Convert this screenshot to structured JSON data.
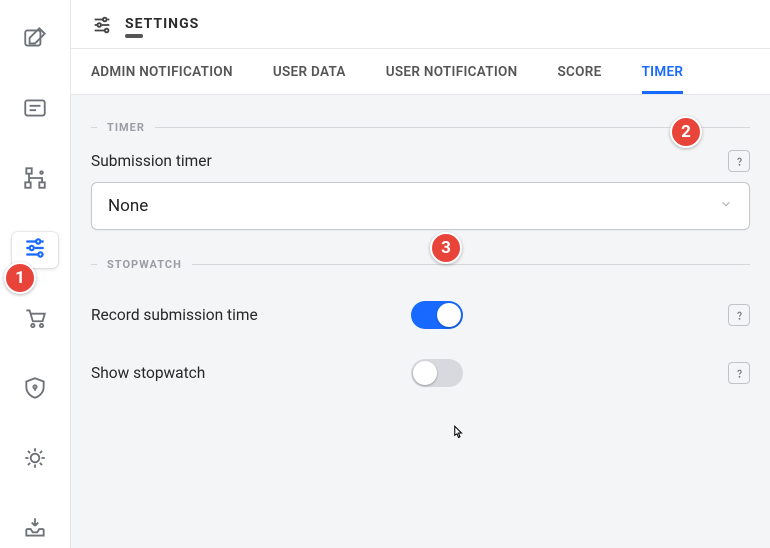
{
  "page": {
    "title": "SETTINGS"
  },
  "tabs": [
    {
      "label": "ADMIN NOTIFICATION",
      "active": false
    },
    {
      "label": "USER DATA",
      "active": false
    },
    {
      "label": "USER NOTIFICATION",
      "active": false
    },
    {
      "label": "SCORE",
      "active": false
    },
    {
      "label": "TIMER",
      "active": true
    }
  ],
  "sections": {
    "timer": {
      "heading": "TIMER",
      "submission_timer_label": "Submission timer",
      "submission_timer_value": "None"
    },
    "stopwatch": {
      "heading": "STOPWATCH",
      "record_label": "Record submission time",
      "record_on": true,
      "show_label": "Show stopwatch",
      "show_on": false
    }
  },
  "annotations": {
    "badge1": "1",
    "badge2": "2",
    "badge3": "3"
  },
  "colors": {
    "accent": "#1769ff",
    "badge": "#e8443a"
  }
}
